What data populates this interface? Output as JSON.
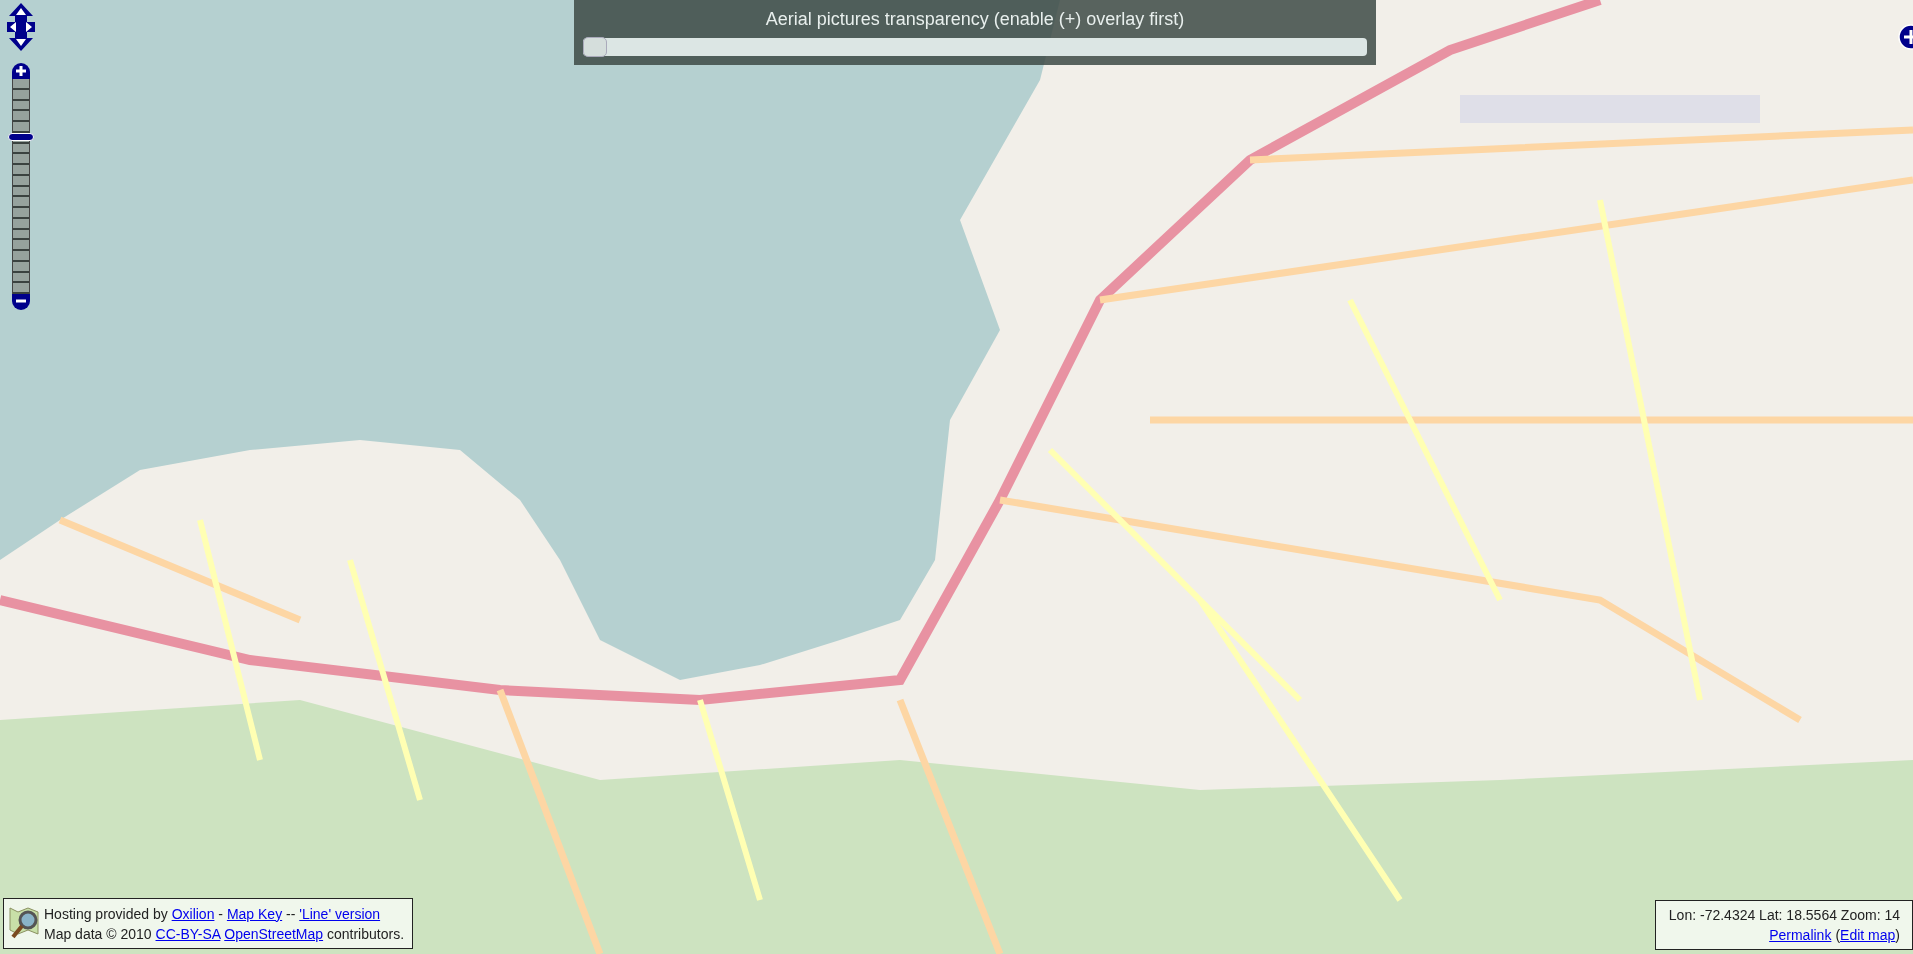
{
  "zoom_control": {
    "level": 0.74
  },
  "transparency_panel": {
    "title": "Aerial pictures transparency (enable (+) overlay first)",
    "level": 0
  },
  "attribution": {
    "lines": [
      [
        {
          "kind": "text",
          "text": "Hosting provided by"
        },
        {
          "kind": "link",
          "text": "Oxilion"
        },
        {
          "kind": "text",
          "text": "-"
        },
        {
          "kind": "link",
          "text": "Map Key"
        },
        {
          "kind": "text",
          "text": "--"
        },
        {
          "kind": "link",
          "text": "'Line' version"
        }
      ],
      [
        {
          "kind": "text",
          "text": "Map data © 2010"
        },
        {
          "kind": "link",
          "text": "CC-BY-SA"
        },
        {
          "kind": "link",
          "text": "OpenStreetMap"
        },
        {
          "kind": "text",
          "text": "contributors."
        }
      ]
    ]
  },
  "position": {
    "text": "Lon: -72.4324 Lat: 18.5564 Zoom: 14",
    "links": [
      {
        "kind": "link",
        "text": "Permalink"
      },
      {
        "kind": "text",
        "text": "("
      },
      {
        "kind": "link",
        "text": "Edit map"
      },
      {
        "kind": "text",
        "text": ")"
      }
    ]
  }
}
